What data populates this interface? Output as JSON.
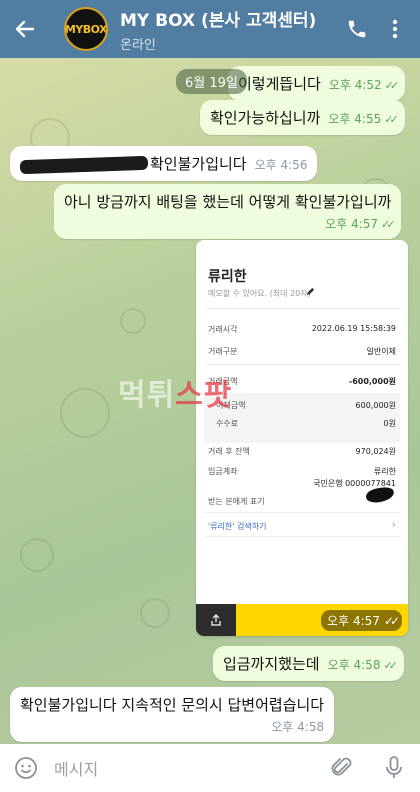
{
  "header": {
    "title": "MY BOX (본사 고객센터)",
    "status": "온라인",
    "avatar_text": "MYBOX"
  },
  "date_pill": "6월 19일",
  "messages": [
    {
      "text": "이렇게뜹니다",
      "time": "오후 4:52",
      "dir": "out"
    },
    {
      "text": "확인가능하십니까",
      "time": "오후 4:55",
      "dir": "out"
    },
    {
      "text": "확인불가입니다",
      "time": "오후 4:56",
      "dir": "in"
    },
    {
      "text": "아니 방금까지 배팅을 했는데 어떻게 확인불가입니까",
      "time": "오후 4:57",
      "dir": "out"
    },
    {
      "text": "입금까지했는데",
      "time": "오후 4:58",
      "dir": "out"
    },
    {
      "text": "확인불가입니다 지속적인 문의시 답변어렵습니다",
      "time": "오후 4:58",
      "dir": "in"
    }
  ],
  "receipt": {
    "name": "류리한",
    "memo_placeholder": "메모할 수 있어요. (최대 20자)",
    "rows": [
      {
        "label": "거래시각",
        "value": "2022.06.19 15:58:39"
      },
      {
        "label": "거래구분",
        "value": "일반이체"
      },
      {
        "label": "거래금액",
        "value": "-600,000원"
      },
      {
        "label": "이체금액",
        "value": "600,000원"
      },
      {
        "label": "수수료",
        "value": "0원"
      },
      {
        "label": "거래 후 잔액",
        "value": "970,024원"
      },
      {
        "label": "입금계좌",
        "value": "류리한"
      },
      {
        "label": "",
        "value": "국민은행 0000077841"
      },
      {
        "label": "받는 분에게 표기",
        "value": ""
      }
    ],
    "search_link": "'류리한' 검색하기",
    "time": "오후 4:57"
  },
  "watermark": {
    "part1": "먹튀",
    "part2": "스팟"
  },
  "composer": {
    "placeholder": "메시지"
  }
}
